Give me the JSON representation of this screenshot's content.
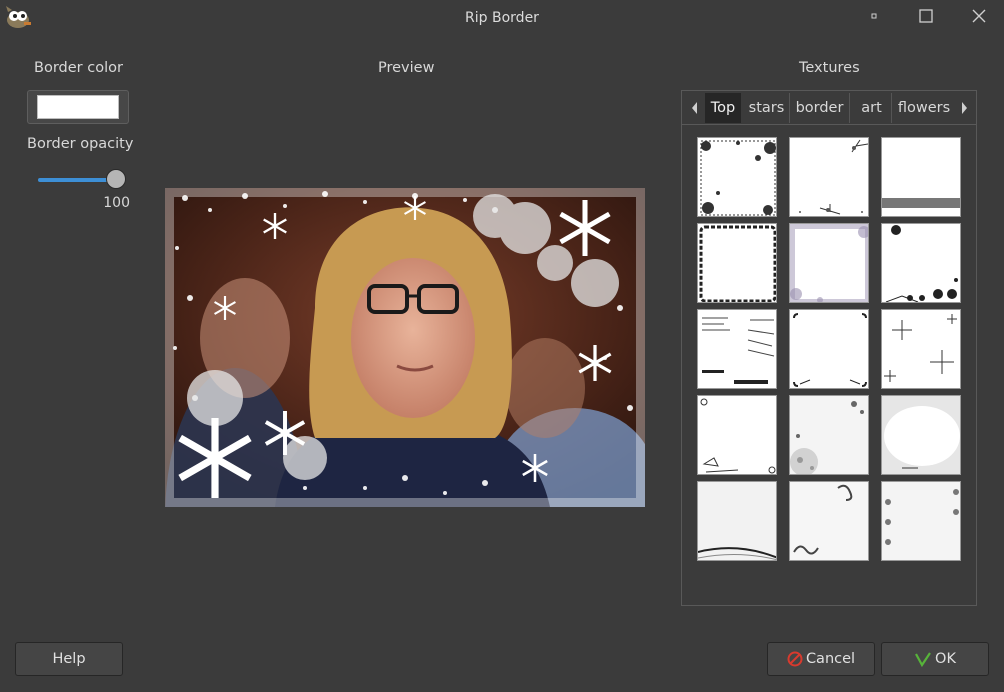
{
  "window": {
    "title": "Rip Border",
    "app_icon": "gimp-wilber-icon",
    "controls": [
      "minimize-icon",
      "maximize-icon",
      "close-icon"
    ]
  },
  "border_color": {
    "label": "Border color",
    "value": "#ffffff"
  },
  "border_opacity": {
    "label": "Border opacity",
    "value": "100",
    "fraction": 1.0
  },
  "preview": {
    "label": "Preview"
  },
  "textures": {
    "label": "Textures",
    "tabs": [
      "Top",
      "stars",
      "border",
      "art",
      "flowers"
    ],
    "active_tab": "Top",
    "thumbnails": [
      "floral-corners",
      "sparkle-lines",
      "gray-stripe",
      "lace-frame",
      "smoky-frame",
      "cartoon-corners",
      "handwriting-left",
      "corner-brackets",
      "star-sparkles",
      "doodle-corners",
      "flower-bubbles",
      "gray-vignette",
      "swoosh-bottom",
      "swirl-ribbon",
      "heart-chain"
    ]
  },
  "buttons": {
    "help": "Help",
    "cancel": "Cancel",
    "ok": "OK"
  },
  "colors": {
    "accent": "#3d8fd6",
    "cancel_icon": "#d83a2e",
    "ok_icon": "#57b33a"
  }
}
